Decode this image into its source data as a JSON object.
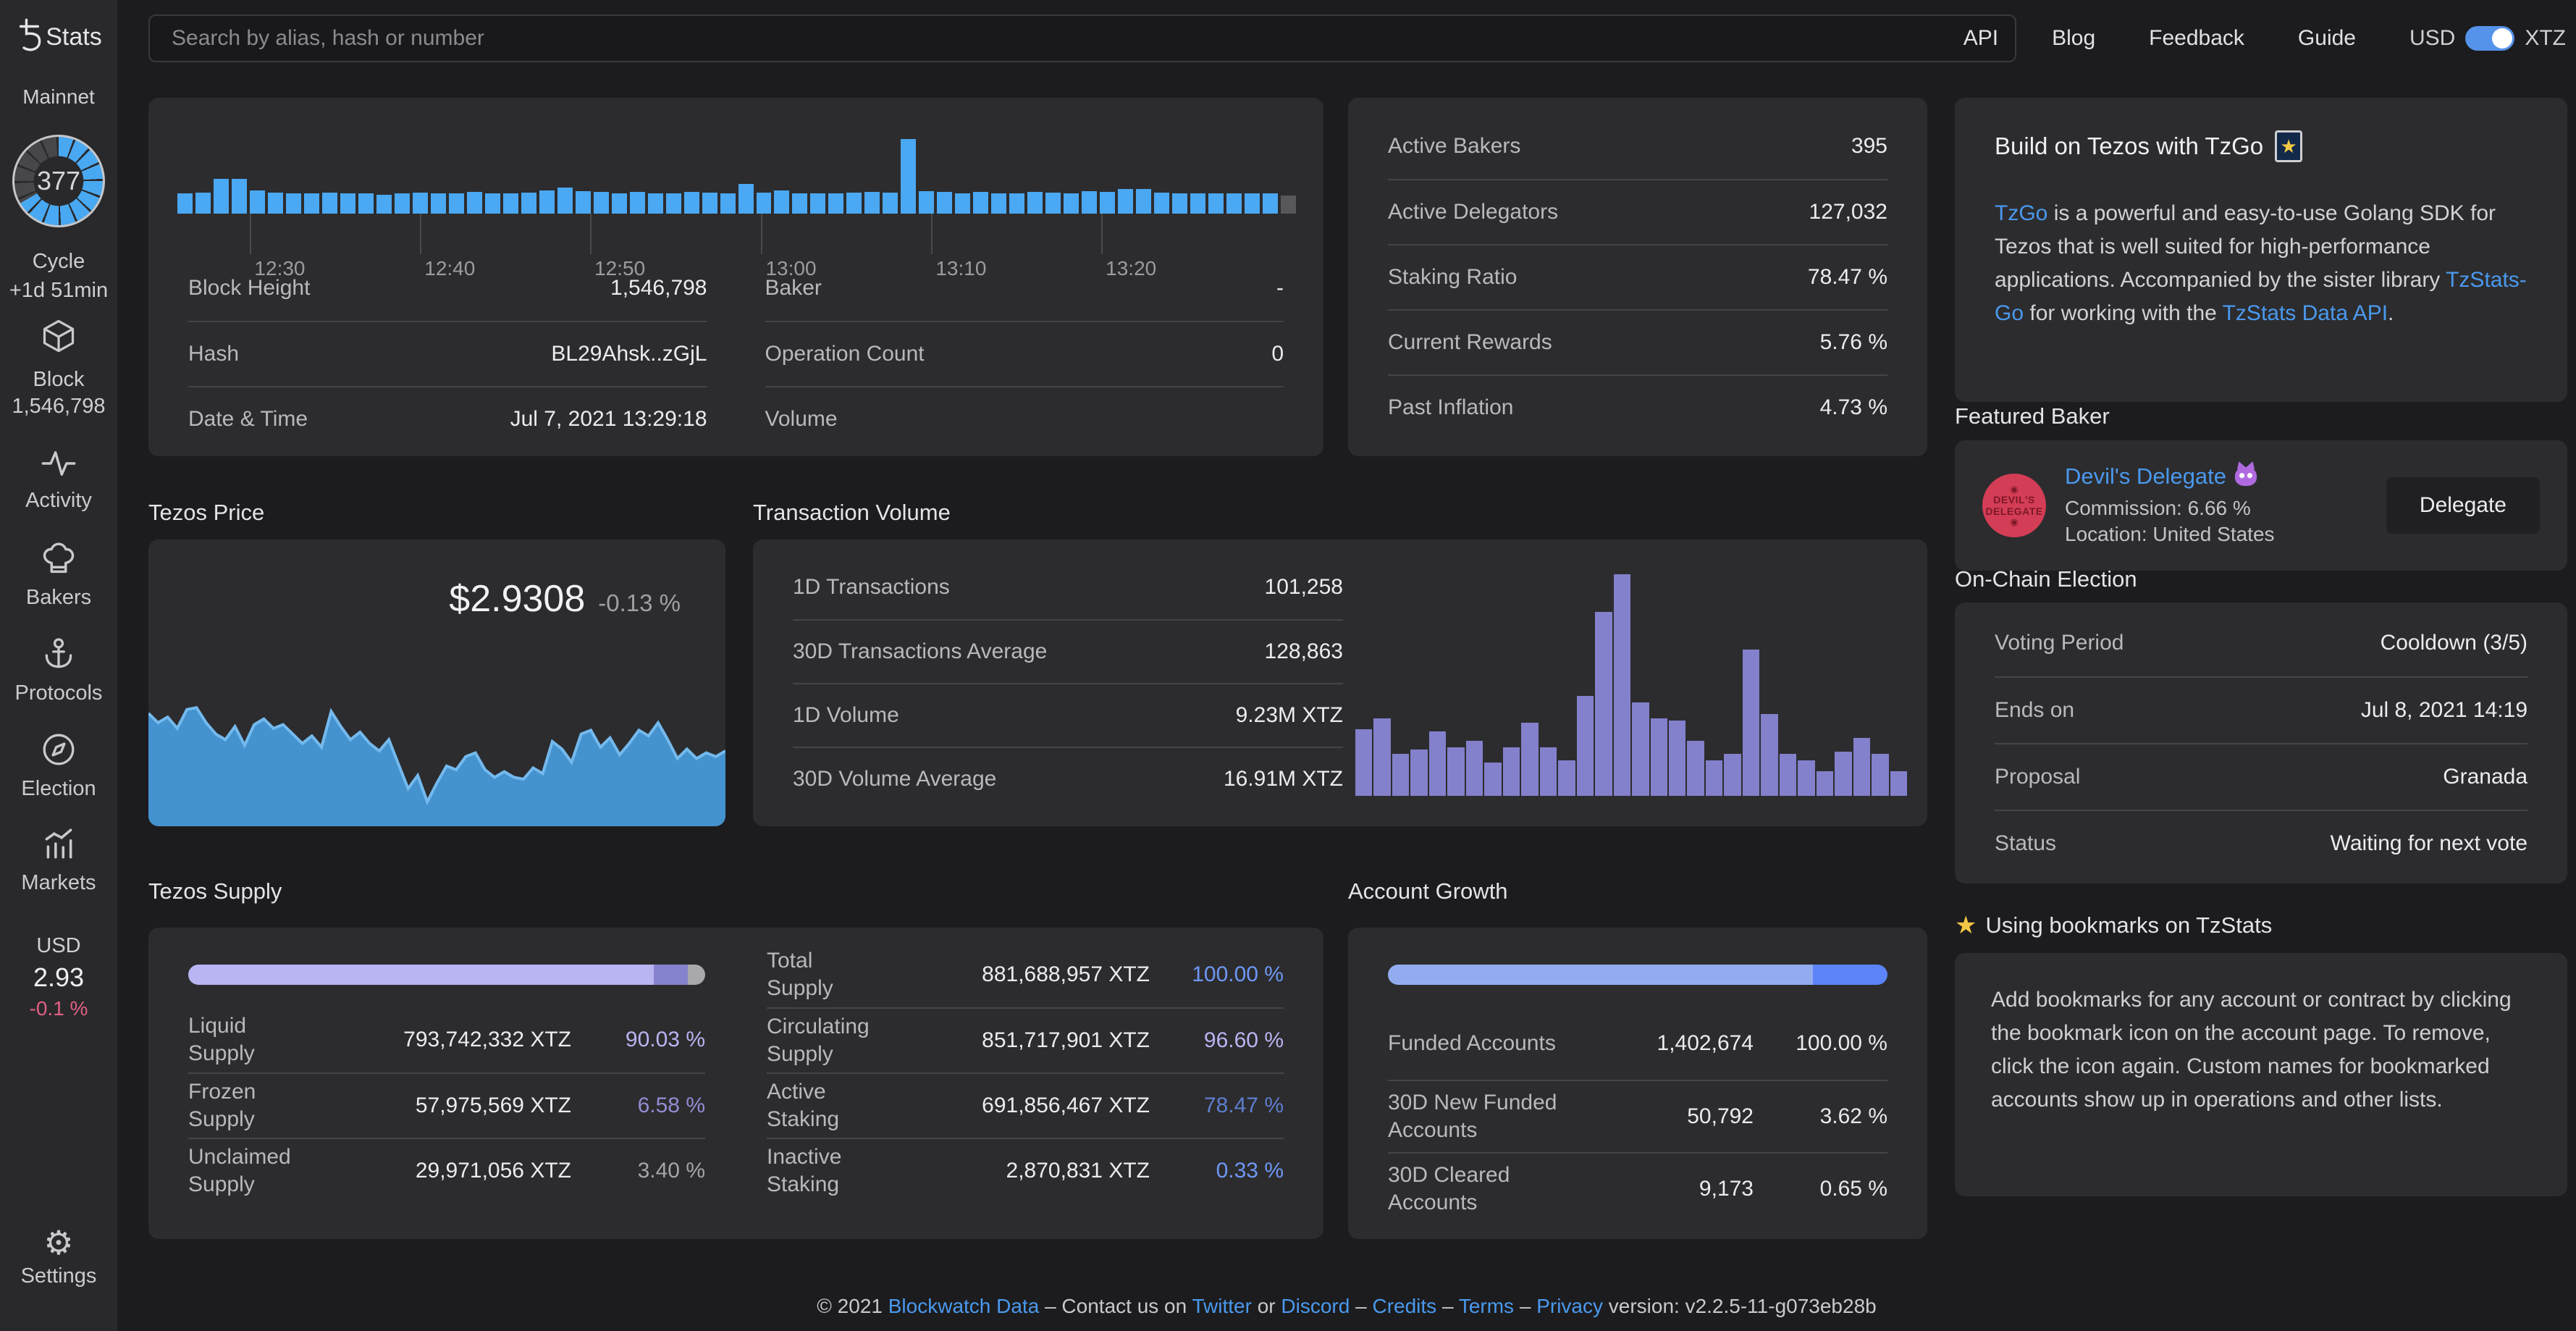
{
  "colors": {
    "page_bg": "#1c1c1e",
    "sidebar_bg": "#29292b",
    "card_bg": "#2c2c2e",
    "accent_blue": "#4ba8f2",
    "link_blue": "#4a99ee",
    "purple_bar": "#8381cc",
    "lavender": "#b9b4f2",
    "growth_light": "#93acf0",
    "growth_bright": "#5c84f8",
    "negative_pink": "#e15f82",
    "toggle_blue": "#5593ea"
  },
  "sidebar": {
    "logo_text": "Stats",
    "network": "Mainnet",
    "cycle": {
      "number": "377",
      "label": "Cycle",
      "eta": "+1d 51min"
    },
    "block": {
      "label": "Block",
      "value": "1,546,798"
    },
    "items": [
      {
        "label": "Activity",
        "icon": "activity-icon"
      },
      {
        "label": "Bakers",
        "icon": "chef-hat-icon"
      },
      {
        "label": "Protocols",
        "icon": "anchor-icon"
      },
      {
        "label": "Election",
        "icon": "compass-icon"
      },
      {
        "label": "Markets",
        "icon": "bar-chart-icon"
      }
    ],
    "price": {
      "currency": "USD",
      "value": "2.93",
      "change": "-0.1 %"
    },
    "settings_label": "Settings"
  },
  "topbar": {
    "search_placeholder": "Search by alias, hash or number",
    "links": [
      "API",
      "Blog",
      "Feedback",
      "Guide"
    ],
    "toggle": {
      "left": "USD",
      "right": "XTZ"
    }
  },
  "block_panel": {
    "ticks": [
      "12:30",
      "12:40",
      "12:50",
      "13:00",
      "13:10",
      "13:20"
    ],
    "tick_positions_pct": [
      6.5,
      21.7,
      36.9,
      52.2,
      67.4,
      82.6
    ],
    "bars": [
      0.24,
      0.25,
      0.42,
      0.42,
      0.28,
      0.25,
      0.24,
      0.24,
      0.25,
      0.24,
      0.24,
      0.23,
      0.24,
      0.25,
      0.24,
      0.24,
      0.26,
      0.24,
      0.24,
      0.25,
      0.28,
      0.31,
      0.27,
      0.26,
      0.24,
      0.26,
      0.24,
      0.24,
      0.26,
      0.25,
      0.24,
      0.36,
      0.25,
      0.28,
      0.24,
      0.24,
      0.24,
      0.25,
      0.26,
      0.25,
      0.9,
      0.27,
      0.26,
      0.24,
      0.26,
      0.24,
      0.24,
      0.26,
      0.25,
      0.24,
      0.27,
      0.26,
      0.3,
      0.3,
      0.25,
      0.24,
      0.24,
      0.24,
      0.24,
      0.24,
      0.24
    ],
    "gray_bar": 0.22,
    "rows_left": [
      {
        "label": "Block Height",
        "value": "1,546,798"
      },
      {
        "label": "Hash",
        "value": "BL29Ahsk..zGjL",
        "link": true
      },
      {
        "label": "Date & Time",
        "value": "Jul 7, 2021 13:29:18"
      }
    ],
    "rows_right": [
      {
        "label": "Baker",
        "value": "-"
      },
      {
        "label": "Operation Count",
        "value": "0"
      },
      {
        "label": "Volume",
        "value": ""
      }
    ]
  },
  "network_stats": {
    "rows": [
      {
        "label": "Active Bakers",
        "value": "395"
      },
      {
        "label": "Active Delegators",
        "value": "127,032"
      },
      {
        "label": "Staking Ratio",
        "value": "78.47 %"
      },
      {
        "label": "Current Rewards",
        "value": "5.76 %"
      },
      {
        "label": "Past Inflation",
        "value": "4.73 %"
      }
    ]
  },
  "price_panel": {
    "title": "Tezos Price",
    "price": "$2.9308",
    "change": "-0.13 %",
    "points": [
      0.6,
      0.55,
      0.58,
      0.52,
      0.62,
      0.63,
      0.55,
      0.49,
      0.46,
      0.53,
      0.43,
      0.54,
      0.57,
      0.52,
      0.54,
      0.49,
      0.44,
      0.48,
      0.42,
      0.61,
      0.53,
      0.46,
      0.5,
      0.44,
      0.4,
      0.46,
      0.33,
      0.2,
      0.27,
      0.13,
      0.23,
      0.32,
      0.3,
      0.37,
      0.39,
      0.3,
      0.26,
      0.29,
      0.26,
      0.25,
      0.31,
      0.28,
      0.45,
      0.41,
      0.34,
      0.49,
      0.51,
      0.42,
      0.47,
      0.38,
      0.44,
      0.51,
      0.48,
      0.55,
      0.46,
      0.36,
      0.41,
      0.36,
      0.39,
      0.37,
      0.4
    ]
  },
  "txvol_panel": {
    "title": "Transaction Volume",
    "rows": [
      {
        "label": "1D Transactions",
        "value": "101,258"
      },
      {
        "label": "30D Transactions Average",
        "value": "128,863"
      },
      {
        "label": "1D Volume",
        "value": "9.23M XTZ"
      },
      {
        "label": "30D Volume Average",
        "value": "16.91M XTZ"
      }
    ],
    "bars": [
      0.3,
      0.35,
      0.19,
      0.21,
      0.29,
      0.22,
      0.25,
      0.15,
      0.22,
      0.33,
      0.22,
      0.16,
      0.45,
      0.83,
      1.0,
      0.42,
      0.35,
      0.34,
      0.25,
      0.16,
      0.19,
      0.66,
      0.37,
      0.19,
      0.16,
      0.11,
      0.2,
      0.26,
      0.19,
      0.11
    ]
  },
  "supply_panel": {
    "title": "Tezos Supply",
    "meter_segments": [
      {
        "pct": 90.03,
        "color": "#b9b4f2"
      },
      {
        "pct": 6.58,
        "color": "#8583ce"
      },
      {
        "pct": 3.39,
        "color": "#a9a9ac"
      }
    ],
    "rows_left": [
      {
        "label": "Liquid Supply",
        "value": "793,742,332 XTZ",
        "pct": "90.03 %",
        "vc": "c-lav",
        "pc": "c-lav"
      },
      {
        "label": "Frozen Supply",
        "value": "57,975,569 XTZ",
        "pct": "6.58 %",
        "vc": "c-lav-dim",
        "pc": "c-lav-dim"
      },
      {
        "label": "Unclaimed Supply",
        "value": "29,971,056 XTZ",
        "pct": "3.40 %",
        "vc": "c-gray",
        "pc": "c-gray"
      }
    ],
    "rows_right": [
      {
        "label": "Total Supply",
        "value": "881,688,957 XTZ",
        "pct": "100.00 %",
        "vc": "c-blue",
        "pc": "c-blue"
      },
      {
        "label": "Circulating Supply",
        "value": "851,717,901 XTZ",
        "pct": "96.60 %",
        "vc": "c-lav",
        "pc": "c-lav"
      },
      {
        "label": "Active Staking",
        "value": "691,856,467 XTZ",
        "pct": "78.47 %",
        "vc": "c-blue-dim",
        "pc": "c-blue-dim"
      },
      {
        "label": "Inactive Staking",
        "value": "2,870,831 XTZ",
        "pct": "0.33 %",
        "vc": "c-blue",
        "pc": "c-blue"
      }
    ]
  },
  "growth_panel": {
    "title": "Account Growth",
    "meter_segments": [
      {
        "pct": 85.0,
        "color": "#93acf0"
      },
      {
        "pct": 15.0,
        "color": "#5c84f8"
      }
    ],
    "rows": [
      {
        "label": "Funded Accounts",
        "value": "1,402,674",
        "pct": "100.00 %"
      },
      {
        "label": "30D New Funded Accounts",
        "value": "50,792",
        "pct": "3.62 %"
      },
      {
        "label": "30D Cleared Accounts",
        "value": "9,173",
        "pct": "0.65 %"
      }
    ]
  },
  "promo": {
    "title": "Build on Tezos with TzGo",
    "icon_glyph": "★",
    "body_segments": [
      {
        "text": "TzGo",
        "link": true
      },
      {
        "text": " is a powerful and easy-to-use Golang SDK for Tezos that is well suited for high-performance applications. Accompanied by the sister library "
      },
      {
        "text": "TzStats-Go",
        "link": true
      },
      {
        "text": " for working with the "
      },
      {
        "text": "TzStats Data API",
        "link": true
      },
      {
        "text": "."
      }
    ]
  },
  "featured_baker": {
    "section_title": "Featured Baker",
    "name": "Devil's Delegate",
    "avatar_lines": [
      "DEVIL'S",
      "DELEGATE"
    ],
    "avatar_eye": "◉",
    "commission": "Commission: 6.66 %",
    "location": "Location: United States",
    "button_label": "Delegate"
  },
  "election": {
    "section_title": "On-Chain Election",
    "rows": [
      {
        "label": "Voting Period",
        "value": "Cooldown (3/5)",
        "link": true
      },
      {
        "label": "Ends on",
        "value": "Jul 8, 2021 14:19"
      },
      {
        "label": "Proposal",
        "value": "Granada"
      },
      {
        "label": "Status",
        "value": "Waiting for next vote"
      }
    ]
  },
  "bookmarks": {
    "section_title": "Using bookmarks on TzStats",
    "star_glyph": "★",
    "body": "Add bookmarks for any account or contract by clicking the bookmark icon on the account page. To remove, click the icon again. Custom names for bookmarked accounts show up in operations and other lists."
  },
  "footer": {
    "segments": [
      {
        "text": "© 2021 "
      },
      {
        "text": "Blockwatch Data",
        "link": true
      },
      {
        "text": " – Contact us on "
      },
      {
        "text": "Twitter",
        "link": true
      },
      {
        "text": " or "
      },
      {
        "text": "Discord",
        "link": true
      },
      {
        "text": " – "
      },
      {
        "text": "Credits",
        "link": true
      },
      {
        "text": " – "
      },
      {
        "text": "Terms",
        "link": true
      },
      {
        "text": " – "
      },
      {
        "text": "Privacy",
        "link": true
      },
      {
        "text": " version: v2.2.5-11-g073eb28b"
      }
    ]
  },
  "chart_data": [
    {
      "type": "bar",
      "title": "Blocks per minute",
      "x_ticks": [
        "12:30",
        "12:40",
        "12:50",
        "13:00",
        "13:10",
        "13:20"
      ],
      "values_rel": [
        0.24,
        0.25,
        0.42,
        0.42,
        0.28,
        0.25,
        0.24,
        0.24,
        0.25,
        0.24,
        0.24,
        0.23,
        0.24,
        0.25,
        0.24,
        0.24,
        0.26,
        0.24,
        0.24,
        0.25,
        0.28,
        0.31,
        0.27,
        0.26,
        0.24,
        0.26,
        0.24,
        0.24,
        0.26,
        0.25,
        0.24,
        0.36,
        0.25,
        0.28,
        0.24,
        0.24,
        0.24,
        0.25,
        0.26,
        0.25,
        0.9,
        0.27,
        0.26,
        0.24,
        0.26,
        0.24,
        0.24,
        0.26,
        0.25,
        0.24,
        0.27,
        0.26,
        0.3,
        0.3,
        0.25,
        0.24,
        0.24,
        0.24,
        0.24,
        0.24,
        0.24
      ]
    },
    {
      "type": "area",
      "title": "Tezos Price",
      "current": 2.9308,
      "change_pct": -0.13,
      "values_rel": [
        0.6,
        0.55,
        0.58,
        0.52,
        0.62,
        0.63,
        0.55,
        0.49,
        0.46,
        0.53,
        0.43,
        0.54,
        0.57,
        0.52,
        0.54,
        0.49,
        0.44,
        0.48,
        0.42,
        0.61,
        0.53,
        0.46,
        0.5,
        0.44,
        0.4,
        0.46,
        0.33,
        0.2,
        0.27,
        0.13,
        0.23,
        0.32,
        0.3,
        0.37,
        0.39,
        0.3,
        0.26,
        0.29,
        0.26,
        0.25,
        0.31,
        0.28,
        0.45,
        0.41,
        0.34,
        0.49,
        0.51,
        0.42,
        0.47,
        0.38,
        0.44,
        0.51,
        0.48,
        0.55,
        0.46,
        0.36,
        0.41,
        0.36,
        0.39,
        0.37,
        0.4
      ]
    },
    {
      "type": "bar",
      "title": "Transaction Volume",
      "values_rel": [
        0.3,
        0.35,
        0.19,
        0.21,
        0.29,
        0.22,
        0.25,
        0.15,
        0.22,
        0.33,
        0.22,
        0.16,
        0.45,
        0.83,
        1.0,
        0.42,
        0.35,
        0.34,
        0.25,
        0.16,
        0.19,
        0.66,
        0.37,
        0.19,
        0.16,
        0.11,
        0.2,
        0.26,
        0.19,
        0.11
      ]
    }
  ]
}
